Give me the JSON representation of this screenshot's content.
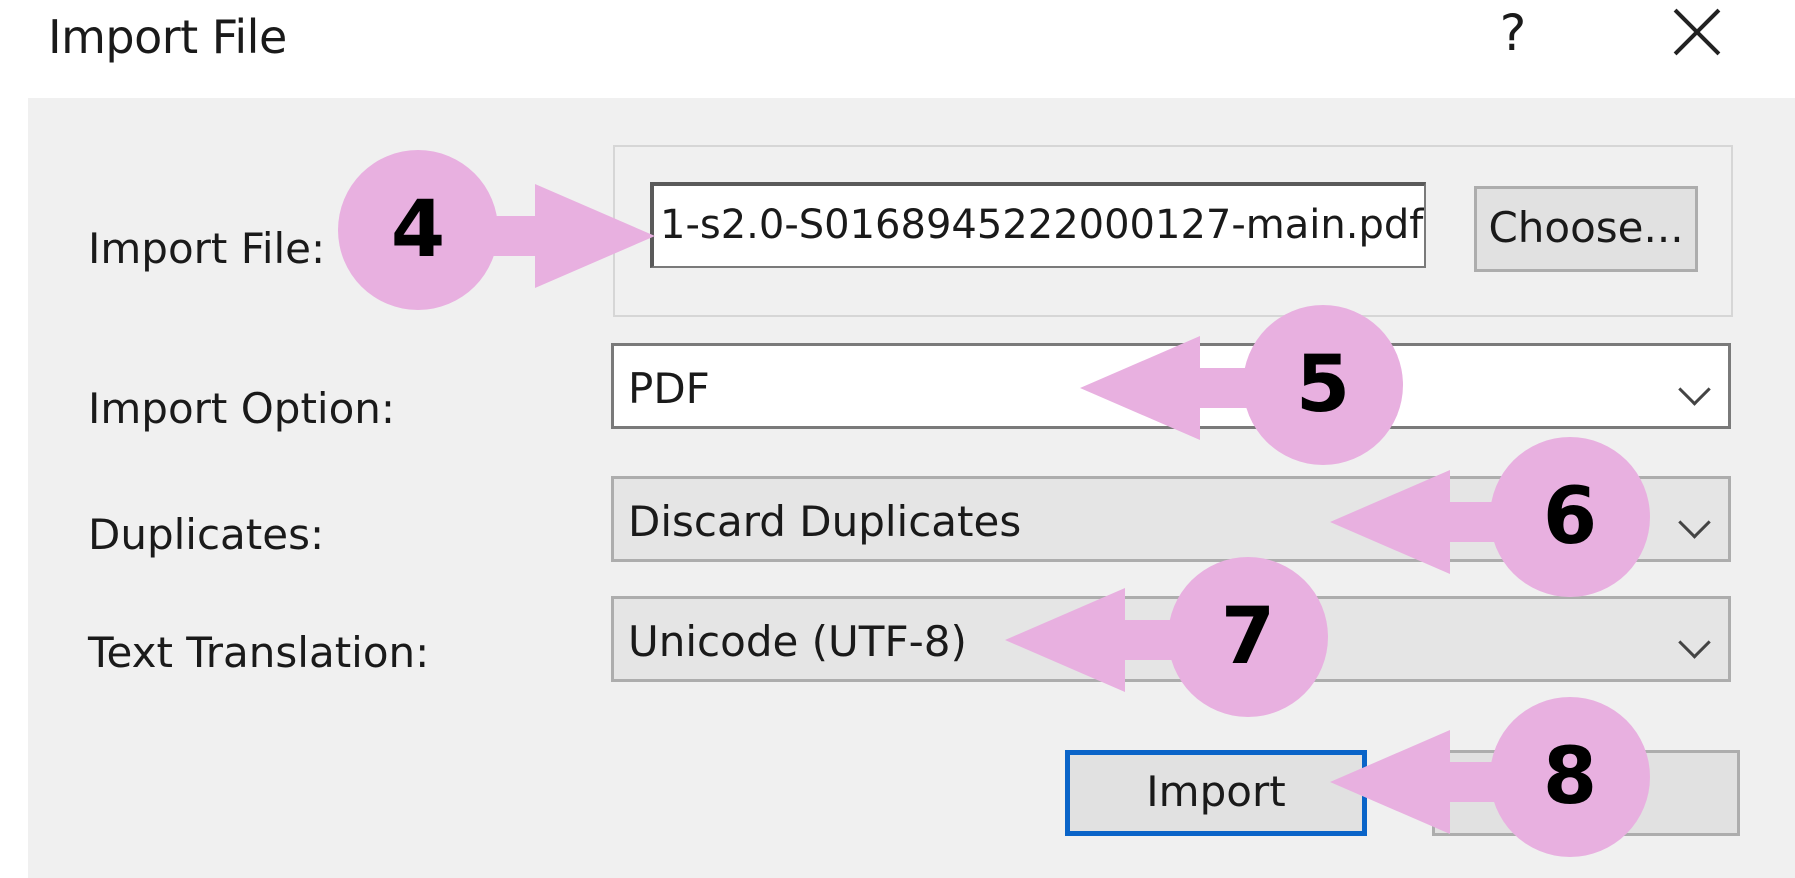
{
  "window": {
    "title": "Import File",
    "help_label": "?",
    "close_icon": "close-icon"
  },
  "form": {
    "import_file_label": "Import File:",
    "import_file_value": "1-s2.0-S0168945222000127-main.pdf",
    "choose_label": "Choose...",
    "import_option_label": "Import Option:",
    "import_option_value": "PDF",
    "duplicates_label": "Duplicates:",
    "duplicates_value": "Discard Duplicates",
    "text_translation_label": "Text Translation:",
    "text_translation_value": "Unicode (UTF-8)",
    "import_button": "Import"
  },
  "callouts": [
    "4",
    "5",
    "6",
    "7",
    "8"
  ],
  "colors": {
    "callout": "#e8b0e0",
    "default_button_border": "#0a64c8"
  }
}
